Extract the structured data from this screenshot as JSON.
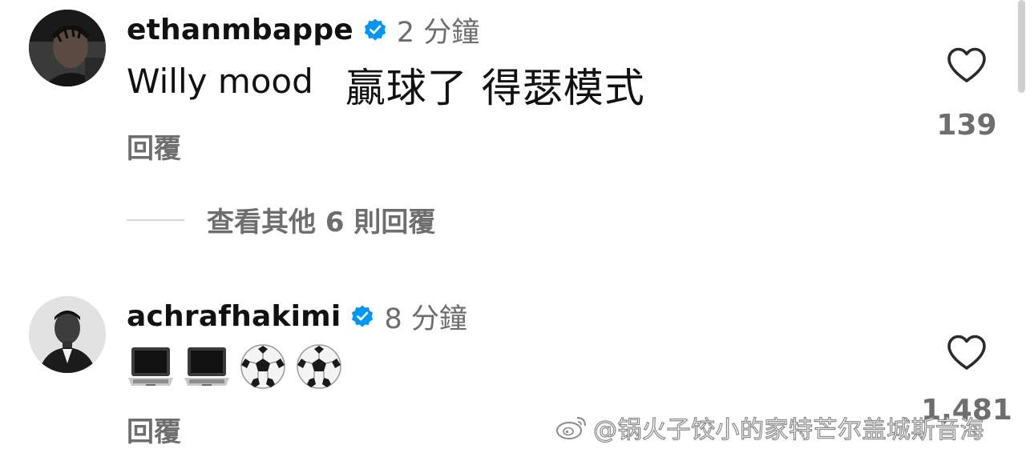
{
  "comments": [
    {
      "username": "ethanmbappe",
      "verified": true,
      "time": "2 分鐘",
      "text_latin": "Willy mood",
      "text_cjk": "贏球了 得瑟模式",
      "reply_label": "回覆",
      "like_count": "139",
      "view_replies": "查看其他 6 則回覆"
    },
    {
      "username": "achrafhakimi",
      "verified": true,
      "time": "8 分鐘",
      "emojis": [
        "laptop-emoji",
        "laptop-emoji",
        "soccer-ball-emoji",
        "soccer-ball-emoji"
      ],
      "reply_label": "回覆",
      "like_count": "1,481"
    }
  ],
  "watermark": {
    "text": "@锅火子饺小的家特芒尔盖城斯音海",
    "logo": "weibo-logo"
  },
  "colors": {
    "text_primary": "#111111",
    "text_secondary": "#6e6e6e",
    "verified_blue": "#0095f6",
    "divider": "#d6d6d6",
    "background": "#ffffff"
  },
  "icons": {
    "like": "heart-outline-icon",
    "verified": "verified-badge-icon"
  }
}
